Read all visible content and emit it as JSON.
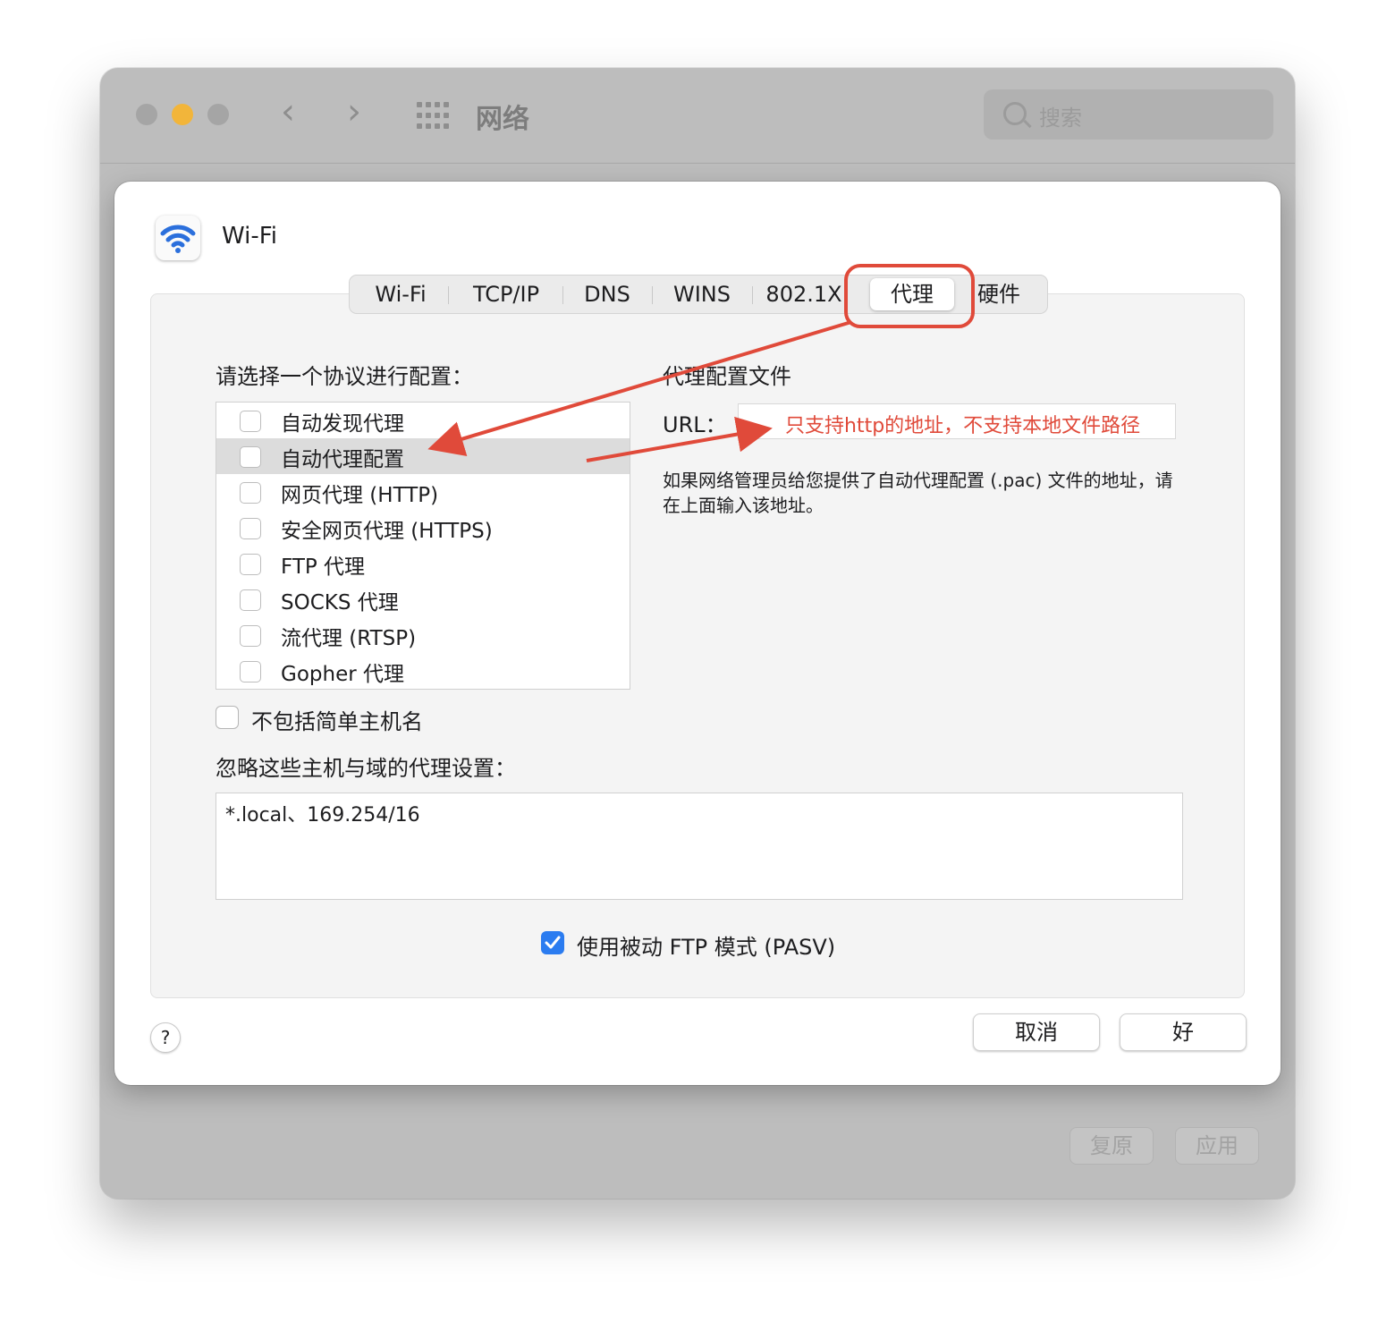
{
  "window": {
    "title": "网络",
    "search_placeholder": "搜索",
    "revert_label": "复原",
    "apply_label": "应用"
  },
  "sheet": {
    "interface_name": "Wi-Fi",
    "tabs": [
      {
        "label": "Wi-Fi"
      },
      {
        "label": "TCP/IP"
      },
      {
        "label": "DNS"
      },
      {
        "label": "WINS"
      },
      {
        "label": "802.1X"
      },
      {
        "label": "代理",
        "active": true
      },
      {
        "label": "硬件"
      }
    ],
    "protocol_prompt": "请选择一个协议进行配置：",
    "protocols": [
      {
        "label": "自动发现代理",
        "checked": false
      },
      {
        "label": "自动代理配置",
        "checked": false,
        "selected": true
      },
      {
        "label": "网页代理 (HTTP)",
        "checked": false
      },
      {
        "label": "安全网页代理 (HTTPS)",
        "checked": false
      },
      {
        "label": "FTP 代理",
        "checked": false
      },
      {
        "label": "SOCKS 代理",
        "checked": false
      },
      {
        "label": "流代理 (RTSP)",
        "checked": false
      },
      {
        "label": "Gopher 代理",
        "checked": false
      }
    ],
    "pac_section_title": "代理配置文件",
    "url_label": "URL：",
    "url_annotation": "只支持http的地址，不支持本地文件路径",
    "pac_description": "如果网络管理员给您提供了自动代理配置 (.pac) 文件的地址，请在上面输入该地址。",
    "exclude_simple_hostnames_label": "不包括简单主机名",
    "exclude_simple_hostnames_checked": false,
    "bypass_label": "忽略这些主机与域的代理设置：",
    "bypass_value": "*.local、169.254/16",
    "passive_ftp_label": "使用被动 FTP 模式 (PASV)",
    "passive_ftp_checked": true,
    "help_label": "?",
    "cancel_label": "取消",
    "ok_label": "好"
  },
  "annotation_color": "#e04a3a",
  "accent_color": "#2b7cf0"
}
